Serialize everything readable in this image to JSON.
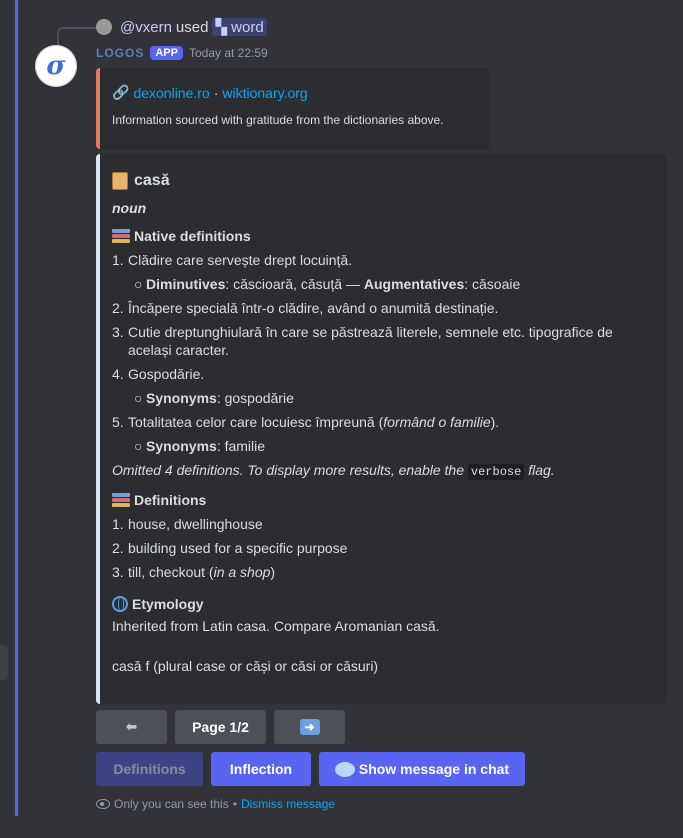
{
  "reply": {
    "user": "@vxern",
    "used_text": "used",
    "command": "word",
    "command_icon": "app-command-icon"
  },
  "bot": {
    "name": "LOGOS",
    "tag": "APP",
    "timestamp": "Today at 22:59",
    "avatar_letter": "σ"
  },
  "sources": {
    "link1": "dexonline.ro",
    "separator": "·",
    "link2": "wiktionary.org",
    "info": "Information sourced with gratitude from the dictionaries above.",
    "accent": "#e07f5e"
  },
  "entry": {
    "word": "casă",
    "part_of_speech": "noun",
    "native_heading": "Native definitions",
    "native": [
      {
        "num": "1.",
        "text": "Clădire care servește drept locuință."
      },
      {
        "num": "2.",
        "text": "Încăpere specială într-o clădire, având o anumită destinație."
      },
      {
        "num": "3.",
        "text": "Cutie dreptunghiulară în care se păstrează literele, semnele etc. tipografice de același caracter."
      },
      {
        "num": "4.",
        "text": "Gospodărie."
      },
      {
        "num": "5.",
        "text_before": "Totalitatea celor care locuiesc împreună (",
        "text_italic": "formând o familie",
        "text_after": ")."
      }
    ],
    "sub1": {
      "label1": "Diminutives",
      "value1": ": căscioară, căsuță — ",
      "label2": "Augmentatives",
      "value2": ": căsoaie"
    },
    "sub4": {
      "label": "Synonyms",
      "value": ": gospodărie"
    },
    "sub5": {
      "label": "Synonyms",
      "value": ": familie"
    },
    "omitted_before": "Omitted 4 definitions. To display more results, enable the ",
    "omitted_code": "verbose",
    "omitted_after": " flag.",
    "definitions_heading": "Definitions",
    "definitions": [
      {
        "num": "1.",
        "text": "house, dwellinghouse"
      },
      {
        "num": "2.",
        "text": "building used for a specific purpose"
      },
      {
        "num": "3.",
        "text_before": "till, checkout (",
        "text_italic": "in a shop",
        "text_after": ")"
      }
    ],
    "etymology_heading": "Etymology",
    "etymology": "Inherited from Latin casa. Compare Aromanian casă.",
    "inflection_line": "casă f (plural case or căși or căsi or căsuri)"
  },
  "pagination": {
    "prev": "⬅",
    "page": "Page 1/2",
    "next": "➡️"
  },
  "actions": {
    "definitions": "Definitions",
    "inflection": "Inflection",
    "show_in_chat": "Show message in chat"
  },
  "footer": {
    "text": "Only you can see this",
    "separator": "•",
    "dismiss": "Dismiss message"
  },
  "colors": {
    "rail": "#5865f2",
    "blurple": "#5865f2",
    "link": "#00a8fc"
  }
}
